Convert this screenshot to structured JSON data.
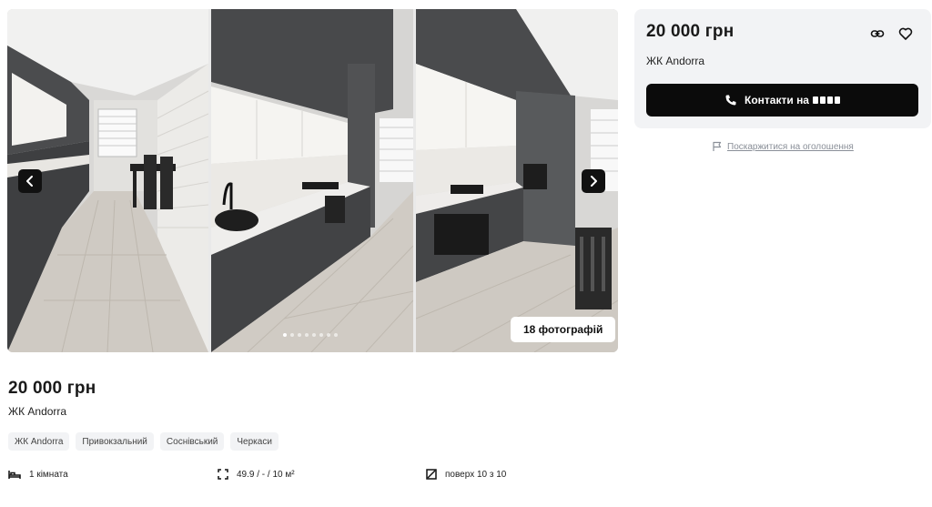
{
  "gallery": {
    "photo_count_label": "18 фотографій",
    "dots_total": 8,
    "dots_active": 0
  },
  "card": {
    "price": "20 000 грн",
    "complex": "ЖК Andorra",
    "contact_label": "Контакти на"
  },
  "report_label": "Поскаржитися на оголошення",
  "listing": {
    "price": "20 000 грн",
    "complex": "ЖК Andorra",
    "tags": [
      "ЖК Andorra",
      "Привокзальний",
      "Соснівський",
      "Черкаси"
    ],
    "features": {
      "rooms": "1 кімната",
      "area": "49.9 / - / 10 м²",
      "floor": "поверх 10 з 10"
    }
  },
  "colors": {
    "accent": "#0b0b0b",
    "card_bg": "#f2f3f5",
    "muted_text": "#8a8f98"
  },
  "icons": [
    "chevron-left-icon",
    "chevron-right-icon",
    "link-icon",
    "heart-icon",
    "phone-icon",
    "flag-icon",
    "bed-icon",
    "area-icon",
    "floor-icon"
  ]
}
